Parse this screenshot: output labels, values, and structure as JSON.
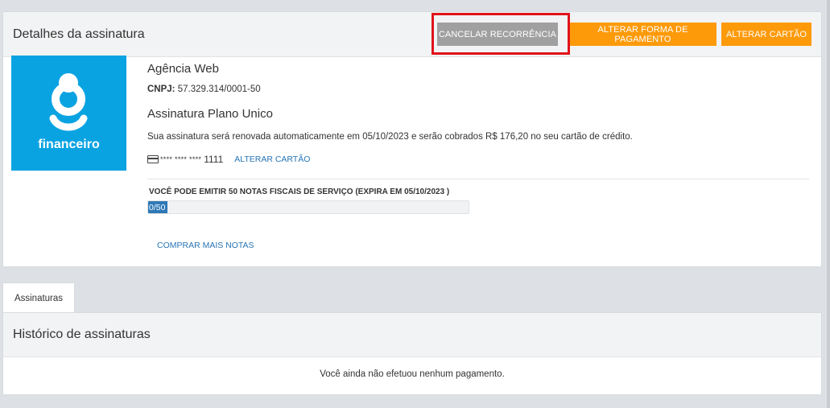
{
  "subscription": {
    "title": "Detalhes da assinatura",
    "buttons": {
      "cancel_recurrence": "CANCELAR RECORRÊNCIA",
      "change_payment": "ALTERAR FORMA DE PAGAMENTO",
      "change_card": "ALTERAR CARTÃO"
    },
    "logo_text": "financeiro",
    "company": "Agência Web",
    "cnpj_label": "CNPJ:",
    "cnpj_value": " 57.329.314/0001-50",
    "plan": "Assinatura Plano Unico",
    "renewal_text": "Sua assinatura será renovada automaticamente em 05/10/2023 e serão cobrados R$ 176,20 no seu cartão de crédito.",
    "card_masked": "**** **** ****",
    "card_last4": "1111",
    "card_link": "ALTERAR CARTÃO",
    "notes_label": "VOCÊ PODE EMITIR 50 NOTAS FISCAIS DE SERVIÇO (EXPIRA EM 05/10/2023 )",
    "notes_progress_text": "0/50",
    "notes_used": 0,
    "notes_total": 50,
    "buy_more": "COMPRAR MAIS NOTAS"
  },
  "tabs": [
    {
      "label": "Assinaturas"
    }
  ],
  "history": {
    "title": "Histórico de assinaturas",
    "empty_message": "Você ainda não efetuou nenhum pagamento."
  },
  "colors": {
    "accent_orange": "#fd9a0a",
    "button_gray": "#a0a0a0",
    "brand_blue": "#0aa3e2",
    "link_blue": "#2775b5",
    "highlight_red": "#e0131a"
  }
}
